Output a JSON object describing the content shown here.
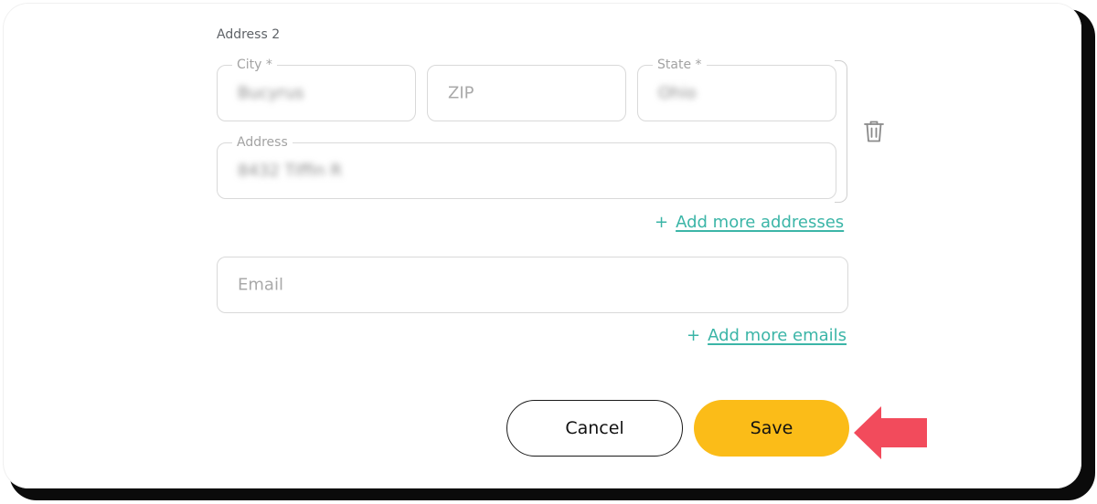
{
  "form": {
    "address2_label": "Address 2",
    "city": {
      "label": "City *",
      "value": "Bucyrus"
    },
    "zip": {
      "placeholder": "ZIP"
    },
    "state": {
      "label": "State *",
      "value": "Ohio"
    },
    "address": {
      "label": "Address",
      "value": "8432 Tiffin R"
    },
    "delete_icon": "trash-icon",
    "add_addresses": {
      "icon": "+",
      "label": "Add more addresses"
    },
    "email": {
      "placeholder": "Email"
    },
    "add_emails": {
      "icon": "+",
      "label": "Add more emails"
    }
  },
  "actions": {
    "cancel_label": "Cancel",
    "save_label": "Save"
  },
  "colors": {
    "accent_link": "#3bb5a7",
    "save_button": "#fbbc18",
    "annotation_arrow": "#f24b5c"
  }
}
